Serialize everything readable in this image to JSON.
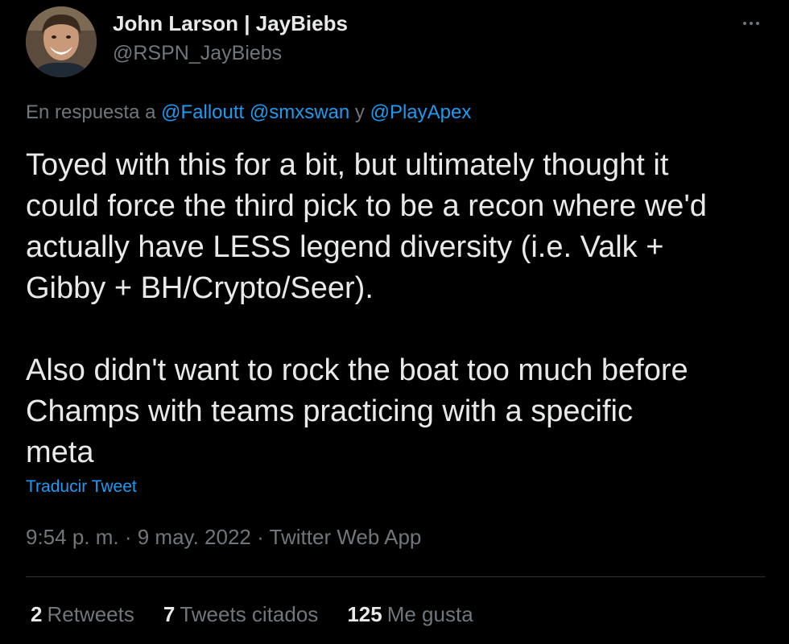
{
  "author": {
    "display_name": "John Larson | JayBiebs",
    "handle": "@RSPN_JayBiebs"
  },
  "reply": {
    "prefix": "En respuesta a ",
    "mention_1": "@Falloutt",
    "sep_1": " ",
    "mention_2": "@smxswan",
    "sep_2": " y ",
    "mention_3": "@PlayApex"
  },
  "tweet": {
    "paragraph_1": "Toyed with this for a bit, but ultimately thought it\ncould force the third pick to be a recon where we'd\nactually have LESS legend diversity (i.e. Valk +\nGibby + BH/Crypto/Seer).",
    "paragraph_2": "Also didn't want to rock the boat too much before\nChamps with teams practicing with a specific\nmeta",
    "translate_label": "Traducir Tweet"
  },
  "meta": {
    "time": "9:54 p. m.",
    "sep_1": " · ",
    "date": "9 may. 2022",
    "sep_2": " · ",
    "source": "Twitter Web App"
  },
  "stats": {
    "retweets_count": "2",
    "retweets_label": "Retweets",
    "quotes_count": "7",
    "quotes_label": "Tweets citados",
    "likes_count": "125",
    "likes_label": "Me gusta"
  },
  "colors": {
    "background": "#000000",
    "text_primary": "#e7e9ea",
    "text_secondary": "#71767b",
    "accent": "#1d9bf0",
    "divider": "#2f3336"
  },
  "icons": {
    "more": "more-horizontal-icon"
  }
}
